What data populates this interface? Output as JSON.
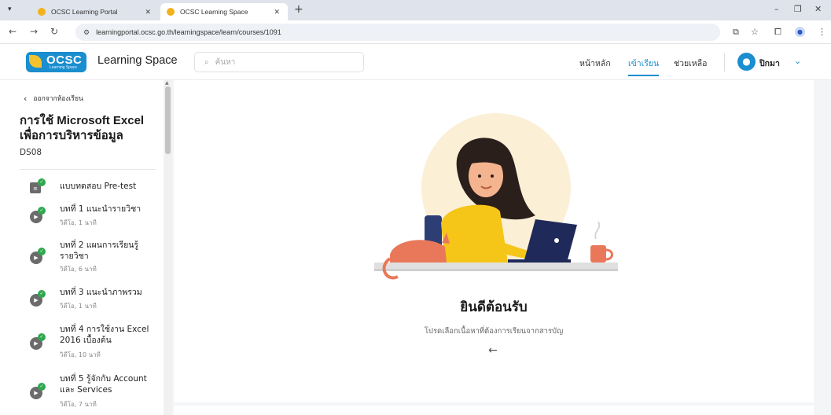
{
  "browser": {
    "tabs": [
      {
        "title": "OCSC Learning Portal",
        "active": false
      },
      {
        "title": "OCSC Learning Space",
        "active": true
      }
    ],
    "url": "learningportal.ocsc.go.th/learningspace/learn/courses/1091"
  },
  "header": {
    "logo_text": "OCSC",
    "logo_sub": "Learning Space",
    "brand_title": "Learning Space",
    "search_placeholder": "ค้นหา",
    "nav": [
      {
        "label": "หน้าหลัก",
        "active": false
      },
      {
        "label": "เข้าเรียน",
        "active": true
      },
      {
        "label": "ช่วยเหลือ",
        "active": false
      }
    ],
    "user_name": "ปิกมา"
  },
  "sidebar": {
    "leave_label": "ออกจากห้องเรียน",
    "course_title": "การใช้ Microsoft Excel เพื่อการบริหารข้อมูล",
    "course_code": "DS08",
    "lessons": [
      {
        "title": "แบบทดสอบ Pre-test",
        "meta": "",
        "icon": "document-icon",
        "completed": true
      },
      {
        "title": "บทที่ 1 แนะนำรายวิชา",
        "meta": "วิดีโอ, 1 นาที",
        "icon": "play-icon",
        "completed": true
      },
      {
        "title": "บทที่ 2 แผนการเรียนรู้ รายวิชา",
        "meta": "วิดีโอ, 6 นาที",
        "icon": "play-icon",
        "completed": true
      },
      {
        "title": "บทที่ 3 แนะนำภาพรวม",
        "meta": "วิดีโอ, 1 นาที",
        "icon": "play-icon",
        "completed": true
      },
      {
        "title": "บทที่ 4 การใช้งาน Excel 2016 เบื้องต้น",
        "meta": "วิดีโอ, 10 นาที",
        "icon": "play-icon",
        "completed": true
      },
      {
        "title": "บทที่ 5 รู้จักกับ Account และ Services",
        "meta": "วิดีโอ, 7 นาที",
        "icon": "play-icon",
        "completed": true
      }
    ]
  },
  "main": {
    "welcome_title": "ยินดีต้อนรับ",
    "welcome_sub": "โปรดเลือกเนื้อหาที่ต้องการเรียนจากสารบัญ"
  },
  "colors": {
    "accent": "#1a8ecf",
    "check": "#2fa84f"
  }
}
